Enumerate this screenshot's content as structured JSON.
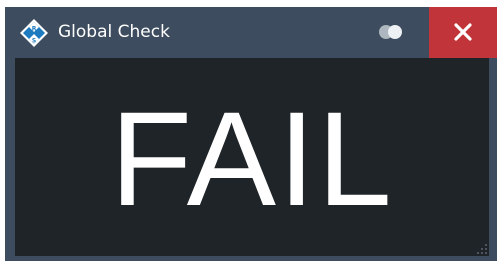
{
  "window": {
    "title": "Global Check",
    "app_icon": "rs-diamond-logo-icon",
    "close_icon": "close-icon",
    "toggle_icon": "toggle-icon"
  },
  "status": {
    "text": "FAIL"
  },
  "colors": {
    "titlebar": "#3d4c5e",
    "close_button": "#c1353a",
    "content_background": "#1f2428",
    "status_text": "#ffffff",
    "logo_blue": "#1f7bbf"
  }
}
